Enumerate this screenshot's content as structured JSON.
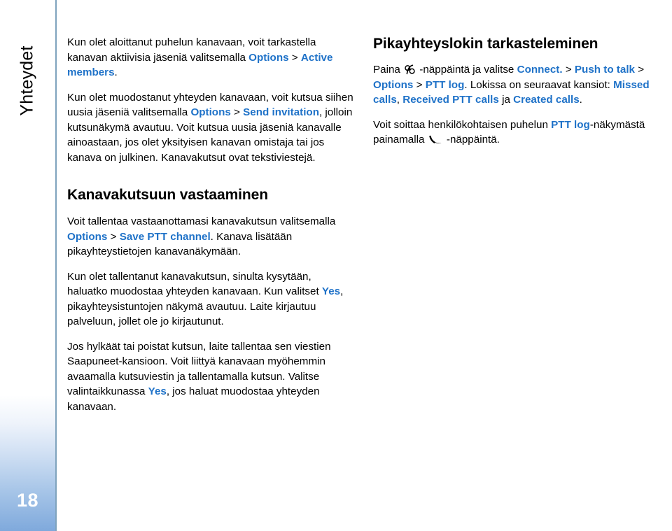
{
  "sidebar": {
    "chapter_label": "Yhteydet",
    "page_number": "18"
  },
  "colors": {
    "ui_term_blue": "#1f72c8",
    "body_text": "#000000",
    "tab_gradient_bottom": "#7fa9dc",
    "divider": "#7fa3bd",
    "page_number_text": "#ffffff"
  },
  "left_column": {
    "paragraph_1": {
      "t1": "Kun olet aloittanut puhelun kanavaan, voit tarkastella kanavan aktiivisia jäseniä valitsemalla ",
      "ui1": "Options",
      "sep1": " > ",
      "ui2": "Active members",
      "t2": "."
    },
    "paragraph_2": {
      "t1": "Kun olet muodostanut yhteyden kanavaan, voit kutsua siihen uusia jäseniä valitsemalla ",
      "ui1": "Options",
      "sep1": " > ",
      "ui2": "Send invitation",
      "t2": ", jolloin kutsunäkymä avautuu. Voit kutsua uusia jäseniä kanavalle ainoastaan, jos olet yksityisen kanavan omistaja tai jos kanava on julkinen. Kanavakutsut ovat tekstiviestejä."
    },
    "heading": "Kanavakutsuun vastaaminen",
    "paragraph_3": {
      "t1": "Voit tallentaa vastaanottamasi kanavakutsun valitsemalla ",
      "ui1": "Options",
      "sep1": " > ",
      "ui2": "Save PTT channel",
      "t2": ". Kanava lisätään pikayhteystietojen kanavanäkymään."
    },
    "paragraph_4": {
      "t1": "Kun olet tallentanut kanavakutsun, sinulta kysytään, haluatko muodostaa yhteyden kanavaan. Kun valitset ",
      "ui1": "Yes",
      "t2": ", pikayhteysistuntojen näkymä avautuu. Laite kirjautuu palveluun, jollet ole jo kirjautunut."
    },
    "paragraph_5": {
      "t1": "Jos hylkäät tai poistat kutsun, laite tallentaa sen viestien Saapuneet-kansioon. Voit liittyä kanavaan myöhemmin avaamalla kutsuviestin ja tallentamalla kutsun. Valitse valintaikkunassa ",
      "ui1": "Yes",
      "t2": ", jos haluat muodostaa yhteyden kanavaan."
    }
  },
  "right_column": {
    "heading": "Pikayhteyslokin tarkasteleminen",
    "paragraph_1": {
      "t1": "Paina ",
      "icon1": "menu-key-icon",
      "t2": " -näppäintä ja valitse ",
      "ui1": "Connect.",
      "sep1": " > ",
      "ui2": "Push to talk",
      "sep2": " > ",
      "ui3": "Options",
      "sep3": " > ",
      "ui4": "PTT log",
      "t3": ". Lokissa on seuraavat kansiot: ",
      "ui5": "Missed calls",
      "t4": ", ",
      "ui6": "Received PTT calls",
      "t5": " ja ",
      "ui7": "Created calls",
      "t6": "."
    },
    "paragraph_2": {
      "t1": "Voit soittaa henkilökohtaisen puhelun ",
      "ui1": "PTT log",
      "t2": "-näkymästä painamalla ",
      "icon1": "call-key-icon",
      "t3": " -näppäintä."
    }
  }
}
